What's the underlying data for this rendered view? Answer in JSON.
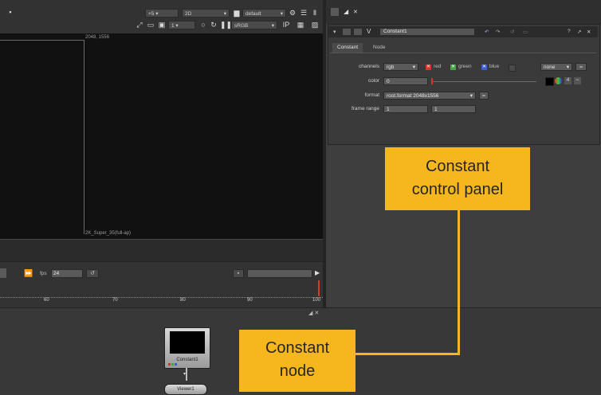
{
  "viewer": {
    "gain": "+5",
    "view_mode": "2D",
    "lut": "default",
    "frame_field": "1",
    "colorspace": "sRGB",
    "format_top_label": "2048, 1556",
    "format_bottom_label": "2K_Super_35(full-ap)",
    "fps_label": "fps",
    "fps_value": "24"
  },
  "timeline": {
    "ticks": [
      "60",
      "70",
      "80",
      "90",
      "100"
    ],
    "end_frame": "100"
  },
  "properties": {
    "node_name": "Constant1",
    "tabs": [
      "Constant",
      "Node"
    ],
    "rows": {
      "channels": {
        "label": "channels",
        "value": "rgb",
        "checks": [
          "red",
          "green",
          "blue"
        ],
        "extra": "none"
      },
      "color": {
        "label": "color",
        "value": "0"
      },
      "format": {
        "label": "format",
        "value": "root.format 2048x1556"
      },
      "frame_range": {
        "label": "frame range",
        "start": "1",
        "end": "1"
      }
    }
  },
  "node_graph": {
    "constant_node_label": "Constant1",
    "viewer_node_label": "Viewer1"
  },
  "callouts": {
    "panel": "Constant control panel",
    "panel_line1": "Constant",
    "panel_line2": "control panel",
    "node_line1": "Constant",
    "node_line2": "node"
  },
  "colors": {
    "callout": "#f6b61e",
    "red": "#d9342b",
    "green": "#3aa84a",
    "blue": "#3b5fd0"
  }
}
